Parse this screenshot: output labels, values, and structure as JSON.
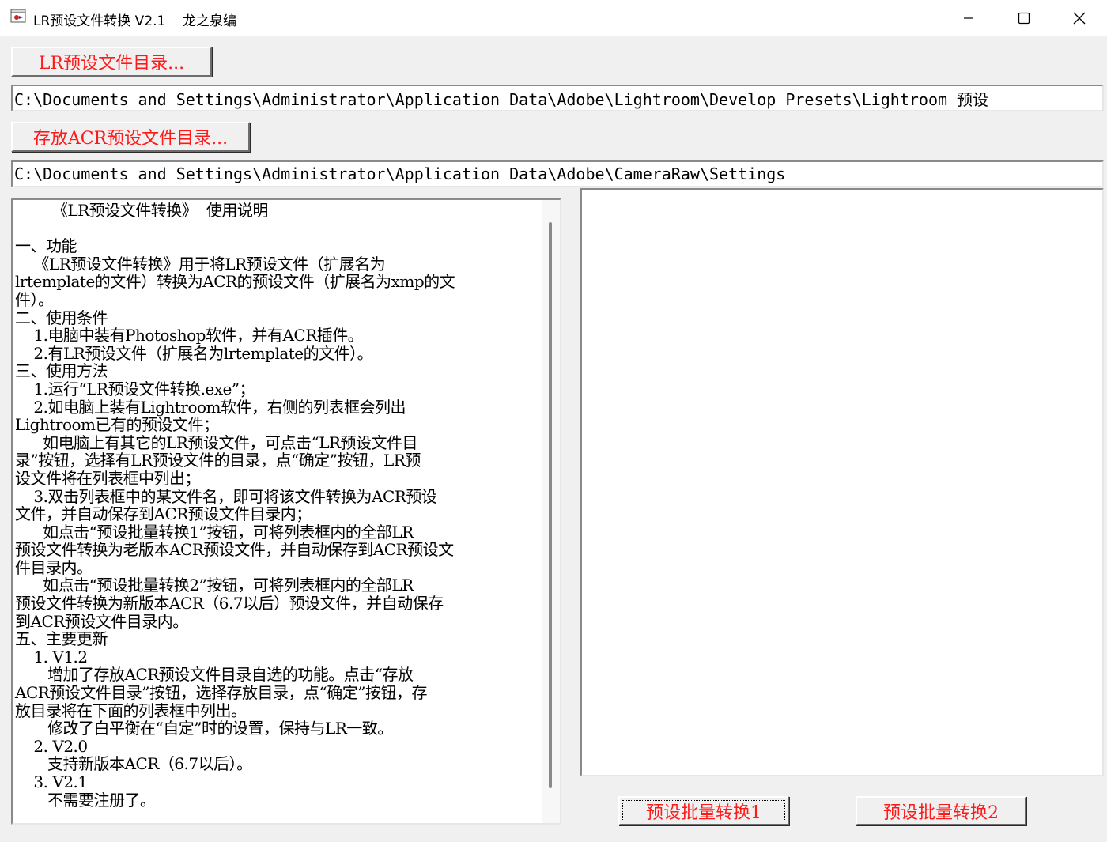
{
  "window": {
    "title": "LR预设文件转换 V2.1    龙之泉编",
    "controls": {
      "minimize": "minimize-icon",
      "maximize": "maximize-icon",
      "close": "close-icon"
    }
  },
  "lr_dir": {
    "button_label": "LR预设文件目录...",
    "path": "C:\\Documents and Settings\\Administrator\\Application Data\\Adobe\\Lightroom\\Develop Presets\\Lightroom 预设"
  },
  "acr_dir": {
    "button_label": "存放ACR预设文件目录...",
    "path": "C:\\Documents and Settings\\Administrator\\Application Data\\Adobe\\CameraRaw\\Settings"
  },
  "instructions": {
    "lines": [
      "        《LR预设文件转换》  使用说明",
      "",
      "一、功能",
      "    《LR预设文件转换》用于将LR预设文件（扩展名为",
      "lrtemplate的文件）转换为ACR的预设文件（扩展名为xmp的文",
      "件）。",
      "二、使用条件",
      "    1.电脑中装有Photoshop软件，并有ACR插件。",
      "    2.有LR预设文件（扩展名为lrtemplate的文件）。",
      "三、使用方法",
      "    1.运行“LR预设文件转换.exe”；",
      "    2.如电脑上装有Lightroom软件，右侧的列表框会列出",
      "Lightroom已有的预设文件；",
      "      如电脑上有其它的LR预设文件，可点击“LR预设文件目",
      "录”按钮，选择有LR预设文件的目录，点“确定”按钮，LR预",
      "设文件将在列表框中列出；",
      "    3.双击列表框中的某文件名，即可将该文件转换为ACR预设",
      "文件，并自动保存到ACR预设文件目录内；",
      "      如点击“预设批量转换1”按钮，可将列表框内的全部LR",
      "预设文件转换为老版本ACR预设文件，并自动保存到ACR预设文",
      "件目录内。",
      "      如点击“预设批量转换2”按钮，可将列表框内的全部LR",
      "预设文件转换为新版本ACR（6.7以后）预设文件，并自动保存",
      "到ACR预设文件目录内。",
      "五、主要更新",
      "    1. V1.2",
      "       增加了存放ACR预设文件目录自选的功能。点击“存放",
      "ACR预设文件目录”按钮，选择存放目录，点“确定”按钮，存",
      "放目录将在下面的列表框中列出。",
      "       修改了白平衡在“自定”时的设置，保持与LR一致。",
      "    2. V2.0",
      "       支持新版本ACR（6.7以后）。",
      "    3. V2.1",
      "       不需要注册了。"
    ]
  },
  "preset_list": {
    "items": []
  },
  "batch": {
    "convert1_label": "预设批量转换1",
    "convert2_label": "预设批量转换2"
  },
  "colors": {
    "button_text": "#ff1a1a",
    "window_bg": "#f0f0f0"
  }
}
